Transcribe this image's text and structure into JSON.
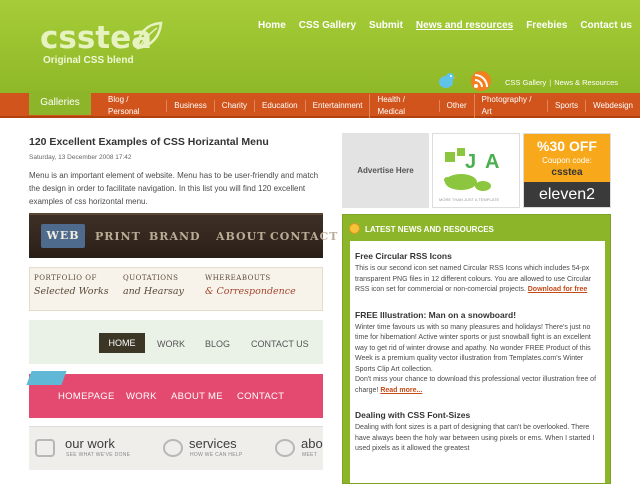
{
  "header": {
    "logo": "csstea",
    "tagline": "Original CSS blend",
    "nav": [
      "Home",
      "CSS Gallery",
      "Submit",
      "News and resources",
      "Freebies",
      "Contact us"
    ],
    "sublinks": [
      "CSS Gallery",
      "News & Resources"
    ]
  },
  "catbar": {
    "galleries_label": "Galleries",
    "categories": [
      "Blog / Personal",
      "Business",
      "Charity",
      "Education",
      "Entertainment",
      "Health / Medical",
      "Other",
      "Photography / Art",
      "Sports",
      "Webdesign"
    ]
  },
  "post": {
    "title": "120 Excellent Examples of CSS Horizantal Menu",
    "date": "Saturday, 13 December 2008 17:42",
    "intro": "Menu is an important element of website. Menu has to be user-friendly and match the design in order to facilitate navigation. In this list you will find 120 excellent examples of css horizontal menu."
  },
  "thumbs": {
    "t1": [
      "WEB",
      "PRINT",
      "BRAND",
      "ABOUT",
      "CONTACT"
    ],
    "t2": [
      {
        "top": "PORTFOLIO OF",
        "bottom": "Selected Works"
      },
      {
        "top": "QUOTATIONS",
        "bottom": "and Hearsay"
      },
      {
        "top": "WHEREABOUTS",
        "bottom": "& Correspondence"
      }
    ],
    "t3": [
      "HOME",
      "WORK",
      "BLOG",
      "CONTACT US"
    ],
    "t4": [
      "HOMEPAGE",
      "WORK",
      "ABOUT ME",
      "CONTACT"
    ],
    "t5": [
      {
        "big": "our work",
        "small": "SEE WHAT WE'VE DONE"
      },
      {
        "big": "services",
        "small": "HOW WE CAN HELP"
      },
      {
        "big": "abo",
        "small": "MEET"
      }
    ]
  },
  "ads": {
    "advertise": "Advertise Here",
    "jqa_tag": "MORE THAN JUST A TEMPLATE",
    "discount": "%30 OFF",
    "coupon_label": "Coupon code:",
    "coupon_code": "csstea",
    "brand": "eleven2"
  },
  "news": {
    "heading": "LATEST NEWS AND RESOURCES",
    "items": [
      {
        "title": "Free Circular RSS Icons",
        "text": "This is our second icon set named Circular RSS Icons which includes 54-px transparent PNG files in 12 different colours. You are allowed to use Circular RSS icon set for commercial or non-comercial projects.",
        "link": "Download for free"
      },
      {
        "title": "FREE Illustration: Man on a snowboard!",
        "text": "Winter time favours us with so many pleasures and holidays! There's just no time for hibernation! Active winter sports or just snowball fight is an excellent way to get rid of winter drowse and apathy. No wonder FREE Product of this Week is a premium quality vector illustration from Templates.com's Winter Sports Clip Art collection.",
        "text2": "Don't miss your chance to download this professional vector illustration free of charge!",
        "link": "Read more..."
      },
      {
        "title": "Dealing with CSS Font-Sizes",
        "text": "Dealing with font sizes is a part of designing that can't be overlooked. There have always been the holy war between using pixels or ems. When I started I used pixels as it allowed the greatest"
      }
    ]
  },
  "colors": {
    "header_green": "#9cc432",
    "category_orange": "#d0541c",
    "link_orange": "#c34a19"
  }
}
